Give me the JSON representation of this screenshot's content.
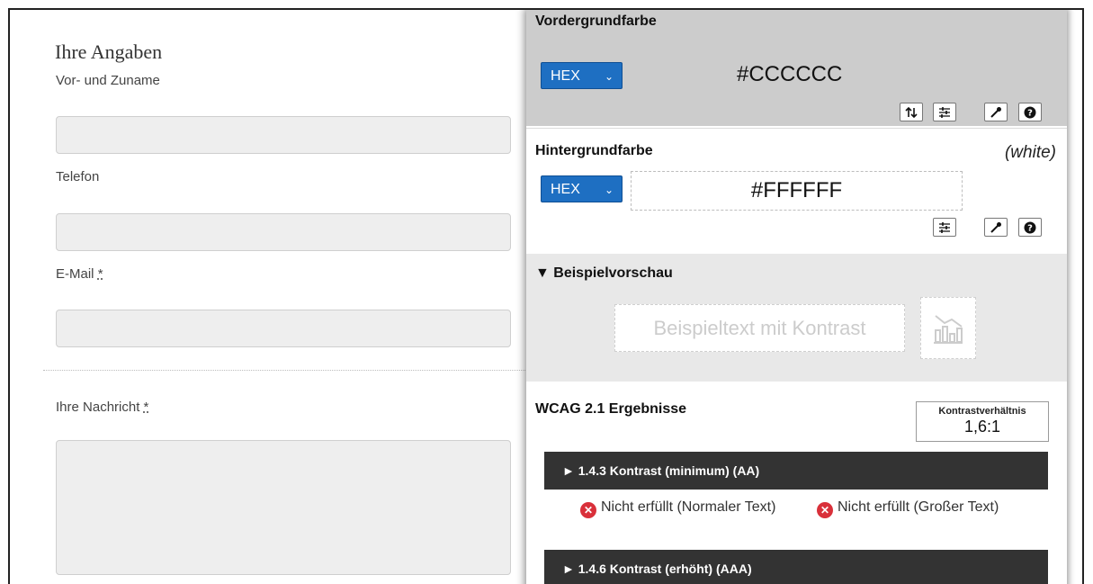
{
  "form": {
    "title": "Ihre Angaben",
    "fields": [
      {
        "label": "Vor- und Zuname",
        "required": ""
      },
      {
        "label": "Telefon",
        "required": ""
      },
      {
        "label": "E-Mail",
        "required": "*"
      },
      {
        "label": "Ihre Nachricht",
        "required": "*"
      }
    ]
  },
  "panel": {
    "foreground": {
      "heading": "Vordergrundfarbe",
      "format": "HEX",
      "value": "#CCCCCC",
      "color": "#cccccc",
      "tools": [
        "swap-icon",
        "sliders-icon",
        "eyedropper-icon",
        "help-icon"
      ]
    },
    "background": {
      "heading": "Hintergrundfarbe",
      "color_name": "(white)",
      "format": "HEX",
      "value": "#FFFFFF",
      "color": "#ffffff",
      "tools": [
        "sliders-icon",
        "eyedropper-icon",
        "help-icon"
      ]
    },
    "preview": {
      "heading": "▼ Beispielvorschau",
      "sample_text": "Beispieltext mit Kontrast"
    },
    "results": {
      "heading": "WCAG 2.1 Ergebnisse",
      "ratio_label": "Kontrastverhältnis",
      "ratio_value": "1,6:1",
      "criteria": [
        {
          "label": "► 1.4.3 Kontrast (minimum) (AA)",
          "normal": "Nicht erfüllt (Normaler Text)",
          "large": "Nicht erfüllt (Großer Text)"
        },
        {
          "label": "► 1.4.6 Kontrast (erhöht) (AAA)"
        }
      ]
    },
    "colors": {
      "accent": "#1e6fc2",
      "fail": "#d9303a",
      "criterion_bg": "#333333"
    }
  }
}
